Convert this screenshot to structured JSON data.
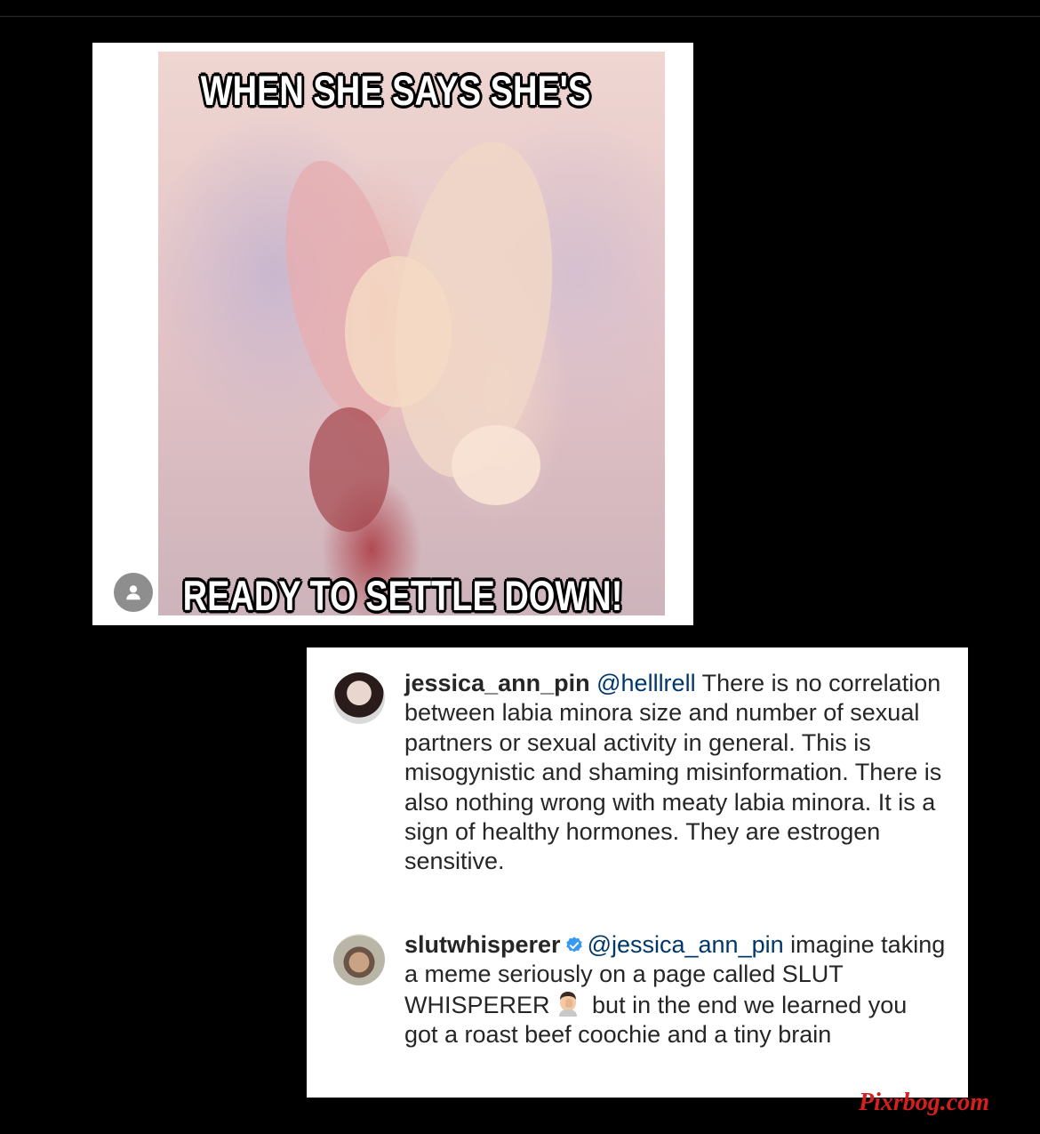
{
  "meme": {
    "caption_top": "WHEN SHE SAYS SHE'S",
    "caption_bottom": "READY TO SETTLE DOWN!"
  },
  "comments": [
    {
      "username": "jessica_ann_pin",
      "mention": "@helllrell",
      "text": " There is no correlation between labia minora size and number of sexual partners or sexual activity in general. This is misogynistic and shaming misinformation.  There is also nothing wrong with meaty labia minora. It is a sign of healthy hormones. They are estrogen sensitive.",
      "verified": false
    },
    {
      "username": "slutwhisperer",
      "mention": "@jessica_ann_pin",
      "text_before_emoji": " imagine taking a meme seriously on a page called SLUT WHISPERER",
      "text_after_emoji": " but in the end we learned you got a roast beef coochie and a tiny brain",
      "verified": true,
      "emoji": "man-facepalming-emoji"
    }
  ],
  "watermark": "Pixrbog.com",
  "colors": {
    "background": "#000000",
    "card": "#ffffff",
    "mention": "#00376b",
    "text": "#262626",
    "verified": "#3897f0",
    "watermark": "#d81e1e"
  }
}
